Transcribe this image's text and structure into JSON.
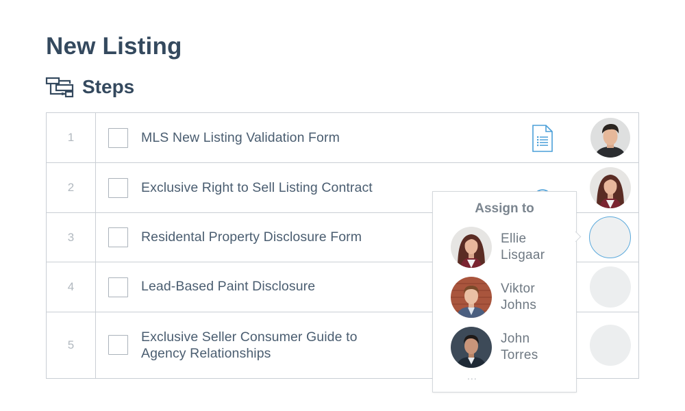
{
  "page": {
    "title": "New Listing"
  },
  "steps_section": {
    "label": "Steps",
    "icon": "workflow-steps-icon"
  },
  "steps": [
    {
      "number": "1",
      "label": "MLS New Listing Validation Form",
      "has_document": true,
      "assignee": "man-dark-hair"
    },
    {
      "number": "2",
      "label": "Exclusive Right to Sell Listing Contract",
      "has_document": true,
      "assignee": "woman-long-hair"
    },
    {
      "number": "3",
      "label": "Residental Property Disclosure Form",
      "has_document": false,
      "assignee": null
    },
    {
      "number": "4",
      "label": "Lead-Based Paint Disclosure",
      "has_document": false,
      "assignee": null
    },
    {
      "number": "5",
      "label_lines": [
        "Exclusive Seller Consumer Guide to",
        "Agency Relationships"
      ],
      "has_document": false,
      "assignee": null
    }
  ],
  "assign_popup": {
    "title": "Assign to",
    "assignees": [
      {
        "first": "Ellie",
        "last": "Lisgaar"
      },
      {
        "first": "Viktor",
        "last": "Johns"
      },
      {
        "first": "John",
        "last": "Torres"
      }
    ],
    "more": "..."
  },
  "colors": {
    "heading": "#34495e",
    "border": "#c9ced4",
    "accent_blue": "#5aa9dc",
    "doc_icon": "#4a9fd8"
  }
}
